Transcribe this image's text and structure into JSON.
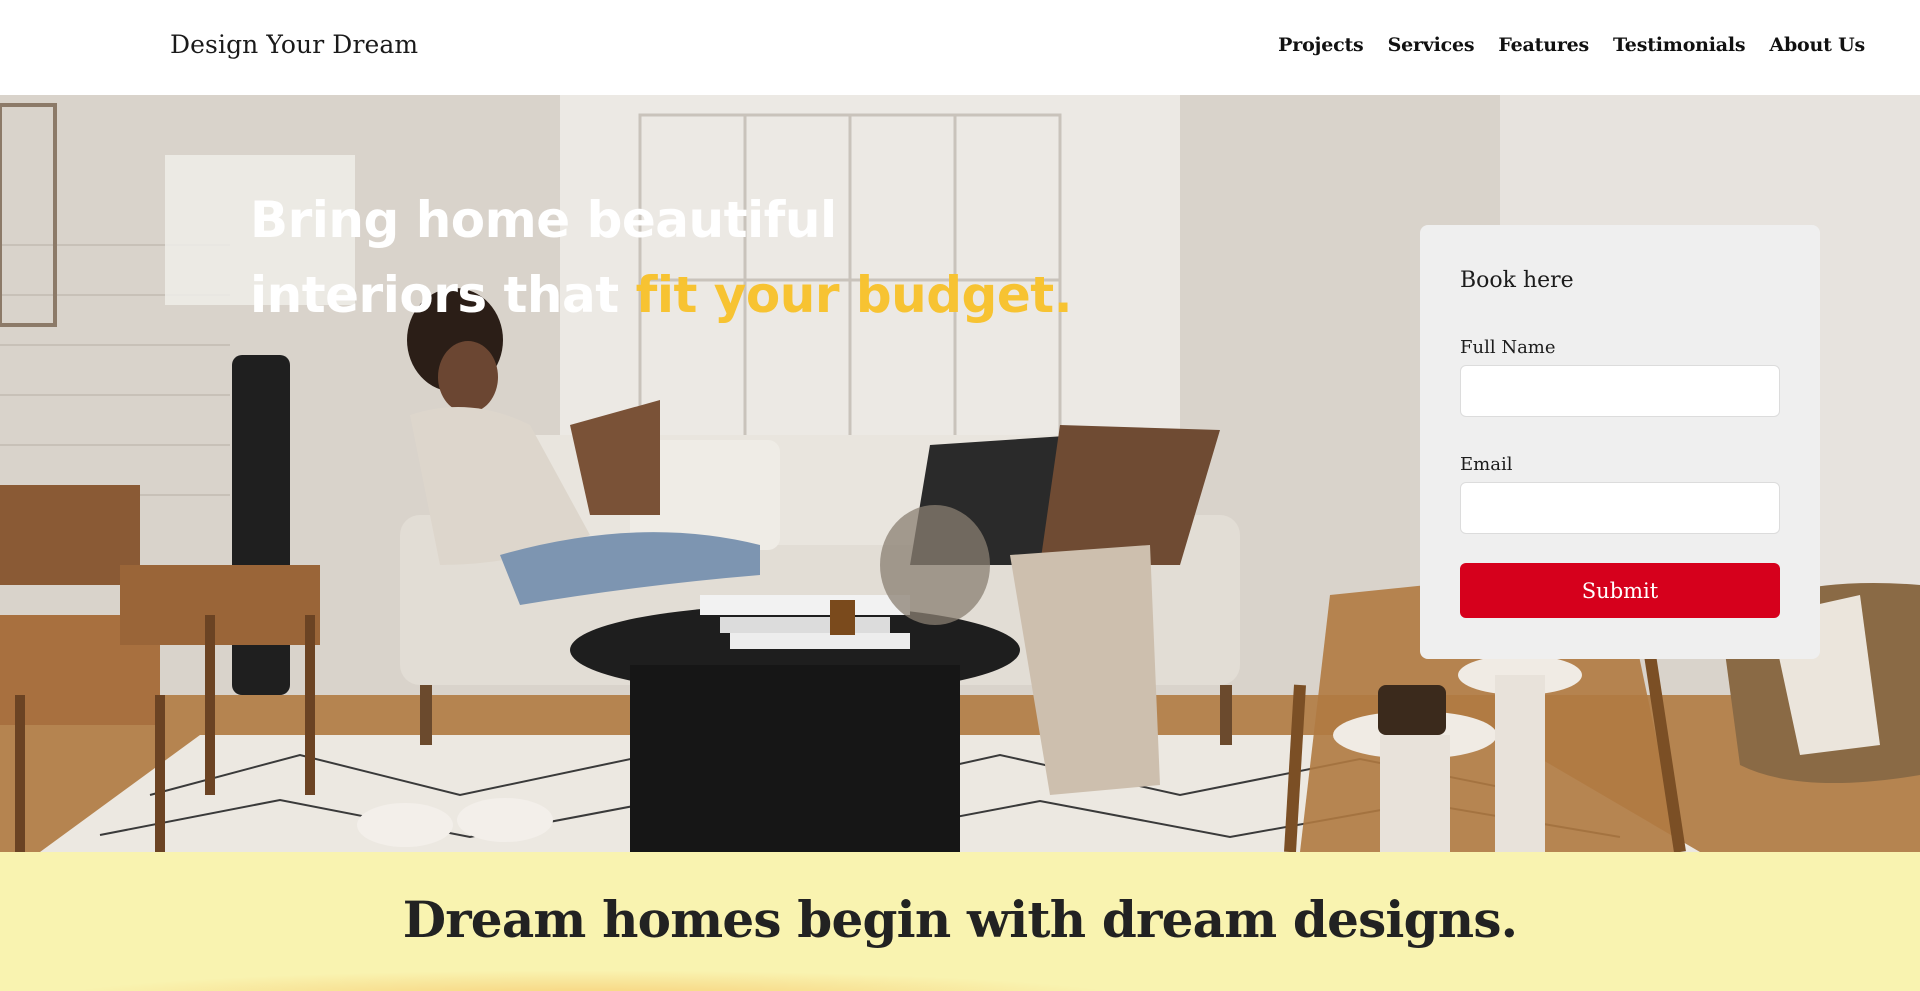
{
  "brand": {
    "name": "Design Your Dream"
  },
  "nav": {
    "items": [
      {
        "label": "Projects"
      },
      {
        "label": "Services"
      },
      {
        "label": "Features"
      },
      {
        "label": "Testimonials"
      },
      {
        "label": "About Us"
      }
    ]
  },
  "hero": {
    "heading_line1": "Bring home beautiful",
    "heading_line2_plain": "interiors that ",
    "heading_line2_accent": "fit your budget.",
    "accent_color": "#f7c332",
    "image_description_icon": "living-room-photo"
  },
  "booking": {
    "title": "Book here",
    "full_name_label": "Full Name",
    "full_name_value": "",
    "email_label": "Email",
    "email_value": "",
    "submit_label": "Submit",
    "submit_color": "#d6001c"
  },
  "banner": {
    "title": "Dream homes begin with dream designs.",
    "background_color": "#f9f3b0"
  }
}
